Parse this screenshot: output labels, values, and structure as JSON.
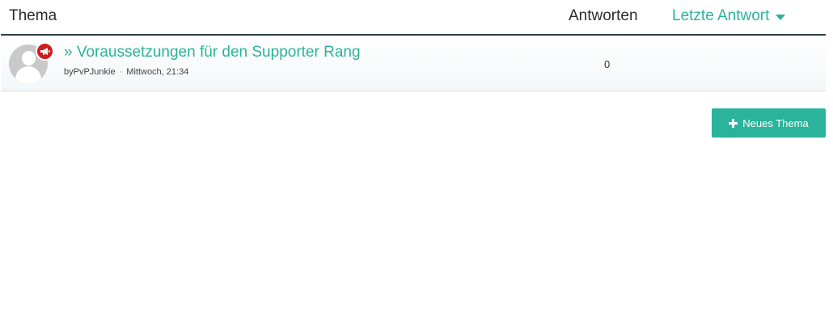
{
  "header": {
    "col_topic": "Thema",
    "col_replies": "Antworten",
    "col_last_reply": "Letzte Antwort"
  },
  "topics": [
    {
      "title": "» Voraussetzungen für den Supporter Rang",
      "author_prefix": "by",
      "author": "PvPJunkie",
      "separator": "·",
      "date": "Mittwoch, 21:34",
      "replies": "0"
    }
  ],
  "actions": {
    "new_topic_label": "Neues Thema"
  },
  "icons": {
    "sort": "caret-down-icon",
    "announcement": "megaphone-icon",
    "add": "plus-icon",
    "avatar": "default-avatar-icon"
  },
  "colors": {
    "accent": "#2bb39b",
    "header_border": "#2c3e48",
    "badge": "#cc1f1f"
  }
}
